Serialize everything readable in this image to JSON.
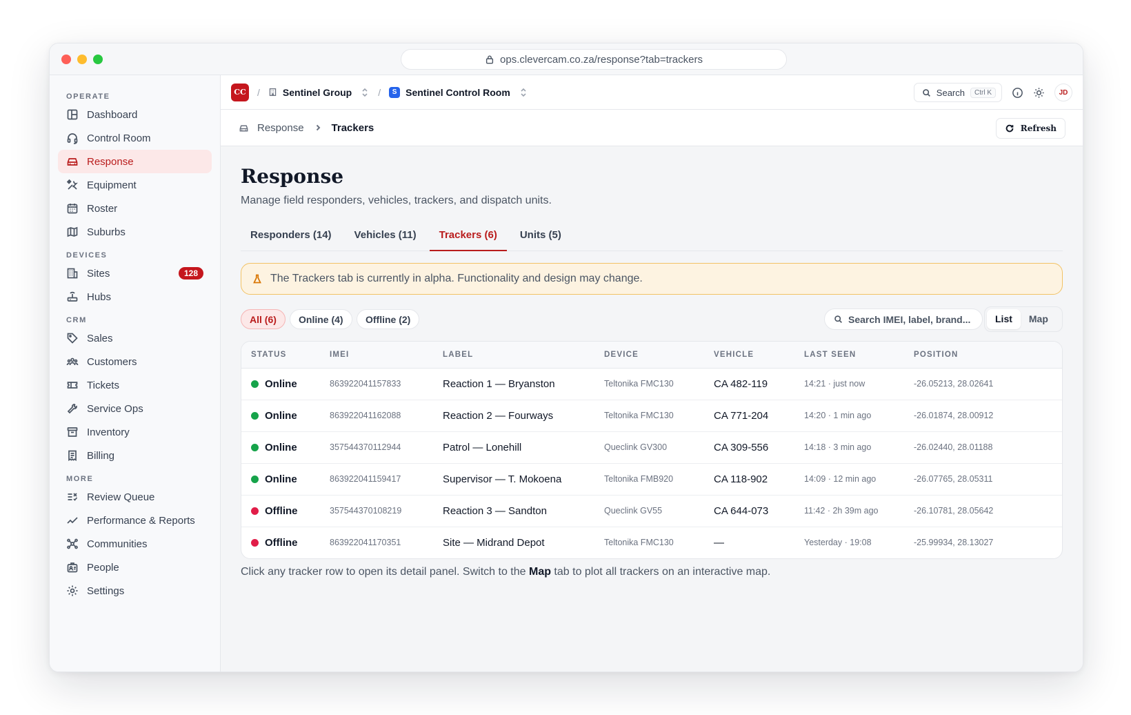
{
  "browser": {
    "url": "ops.clevercam.co.za/response?tab=trackers"
  },
  "sidebar": {
    "sections": [
      {
        "label": "OPERATE",
        "items": [
          {
            "label": "Dashboard",
            "icon": "dashboard-icon"
          },
          {
            "label": "Control Room",
            "icon": "headset-icon"
          },
          {
            "label": "Response",
            "icon": "car-icon",
            "active": true
          },
          {
            "label": "Equipment",
            "icon": "tools-icon"
          },
          {
            "label": "Roster",
            "icon": "calendar-icon"
          },
          {
            "label": "Suburbs",
            "icon": "map-icon"
          }
        ]
      },
      {
        "label": "DEVICES",
        "items": [
          {
            "label": "Sites",
            "icon": "building-icon",
            "badge": "128"
          },
          {
            "label": "Hubs",
            "icon": "router-icon"
          }
        ]
      },
      {
        "label": "CRM",
        "items": [
          {
            "label": "Sales",
            "icon": "tag-icon"
          },
          {
            "label": "Customers",
            "icon": "users-icon"
          },
          {
            "label": "Tickets",
            "icon": "ticket-icon"
          },
          {
            "label": "Service Ops",
            "icon": "wrench-icon"
          },
          {
            "label": "Inventory",
            "icon": "archive-icon"
          },
          {
            "label": "Billing",
            "icon": "receipt-icon"
          }
        ]
      },
      {
        "label": "MORE",
        "items": [
          {
            "label": "Review Queue",
            "icon": "list-check-icon"
          },
          {
            "label": "Performance & Reports",
            "icon": "trend-icon"
          },
          {
            "label": "Communities",
            "icon": "network-icon"
          },
          {
            "label": "People",
            "icon": "id-badge-icon"
          },
          {
            "label": "Settings",
            "icon": "gear-icon"
          }
        ]
      }
    ],
    "active_color": "#b91c1c",
    "badge_color": "#c5161d"
  },
  "topbar": {
    "logo_text": "CC",
    "org_name": "Sentinel Group",
    "workspace_badge": "S",
    "workspace_name": "Sentinel Control Room",
    "search_label": "Search",
    "search_shortcut": "Ctrl K",
    "avatar_initials": "JD"
  },
  "subbar": {
    "parent": "Response",
    "current": "Trackers",
    "refresh_label": "Refresh"
  },
  "page": {
    "title": "Response",
    "subtitle": "Manage field responders, vehicles, trackers, and dispatch units.",
    "tabs": [
      {
        "label": "Responders (14)"
      },
      {
        "label": "Vehicles (11)"
      },
      {
        "label": "Trackers (6)",
        "active": true
      },
      {
        "label": "Units (5)"
      }
    ],
    "alert": "The Trackers tab is currently in alpha. Functionality and design may change.",
    "filters": {
      "all": "All (6)",
      "online": "Online (4)",
      "offline": "Offline (2)",
      "search_placeholder": "Search IMEI, label, brand...",
      "view_list": "List",
      "view_map": "Map"
    },
    "table": {
      "headers": [
        "STATUS",
        "IMEI",
        "LABEL",
        "DEVICE",
        "VEHICLE",
        "LAST SEEN",
        "POSITION"
      ],
      "rows": [
        {
          "status": "Online",
          "imei": "863922041157833",
          "label": "Reaction 1 — Bryanston",
          "device": "Teltonika FMC130",
          "vehicle": "CA 482-119",
          "last_seen": "14:21 · just now",
          "position": "-26.05213, 28.02641"
        },
        {
          "status": "Online",
          "imei": "863922041162088",
          "label": "Reaction 2 — Fourways",
          "device": "Teltonika FMC130",
          "vehicle": "CA 771-204",
          "last_seen": "14:20 · 1 min ago",
          "position": "-26.01874, 28.00912"
        },
        {
          "status": "Online",
          "imei": "357544370112944",
          "label": "Patrol — Lonehill",
          "device": "Queclink GV300",
          "vehicle": "CA 309-556",
          "last_seen": "14:18 · 3 min ago",
          "position": "-26.02440, 28.01188"
        },
        {
          "status": "Online",
          "imei": "863922041159417",
          "label": "Supervisor — T. Mokoena",
          "device": "Teltonika FMB920",
          "vehicle": "CA 118-902",
          "last_seen": "14:09 · 12 min ago",
          "position": "-26.07765, 28.05311"
        },
        {
          "status": "Offline",
          "imei": "357544370108219",
          "label": "Reaction 3 — Sandton",
          "device": "Queclink GV55",
          "vehicle": "CA 644-073",
          "last_seen": "11:42 · 2h 39m ago",
          "position": "-26.10781, 28.05642"
        },
        {
          "status": "Offline",
          "imei": "863922041170351",
          "label": "Site — Midrand Depot",
          "device": "Teltonika FMC130",
          "vehicle": "—",
          "last_seen": "Yesterday · 19:08",
          "position": "-25.99934, 28.13027"
        }
      ]
    },
    "footer_pre": "Click any tracker row to open its detail panel. Switch to the ",
    "footer_bold": "Map",
    "footer_post": " tab to plot all trackers on an interactive map."
  },
  "colors": {
    "online": "#16a34a",
    "offline": "#e11d48",
    "accent": "#b91c1c",
    "alert_bg": "#fdf3e1",
    "alert_border": "#f2c265"
  }
}
